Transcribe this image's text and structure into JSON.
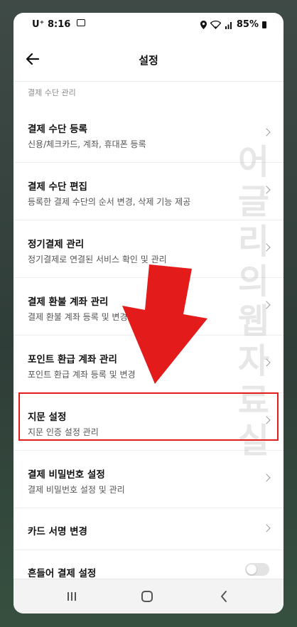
{
  "status_bar": {
    "carrier": "U⁺",
    "time": "8:16",
    "battery": "85%"
  },
  "header": {
    "title": "설정",
    "back_icon": "arrow-left-icon"
  },
  "section_title": "결제 수단 관리",
  "items": [
    {
      "title": "결제 수단 등록",
      "subtitle": "신용/체크카드, 계좌, 휴대폰 등록"
    },
    {
      "title": "결제 수단 편집",
      "subtitle": "등록한 결제 수단의 순서 변경, 삭제 기능 제공"
    },
    {
      "title": "정기결제 관리",
      "subtitle": "정기결제로 연결된 서비스 확인 및 관리"
    },
    {
      "title": "결제 환불 계좌 관리",
      "subtitle": "결제 환불 계좌 등록 및 변경"
    },
    {
      "title": "포인트 환급 계좌 관리",
      "subtitle": "포인트 환급 계좌 등록 및 변경"
    },
    {
      "title": "지문 설정",
      "subtitle": "지문 인증 설정 관리"
    },
    {
      "title": "결제 비밀번호 설정",
      "subtitle": "결제 비밀번호 설정 및 관리"
    },
    {
      "title": "카드 서명 변경"
    },
    {
      "title": "흔들어 결제 설정",
      "toggle": "off"
    }
  ],
  "watermark": "어글리의웹자료실",
  "colors": {
    "highlight": "#e31b1b",
    "arrow": "#e31b1b"
  }
}
